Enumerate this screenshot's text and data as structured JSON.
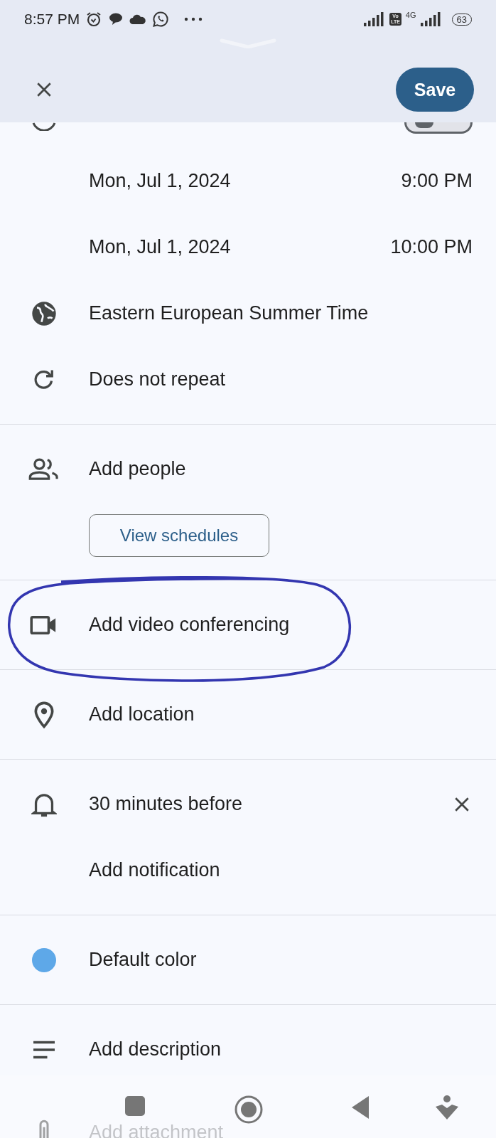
{
  "status_bar": {
    "time": "8:57 PM",
    "volte": [
      "Vo",
      "LTE"
    ],
    "network": "4G",
    "battery": "63"
  },
  "header": {
    "save_button": "Save"
  },
  "all_day_toggle": {
    "on": false
  },
  "sections": [
    {
      "rows": [
        {
          "kind": "datetime",
          "date": "Mon, Jul 1, 2024",
          "time": "9:00 PM"
        },
        {
          "kind": "datetime",
          "date": "Mon, Jul 1, 2024",
          "time": "10:00 PM"
        },
        {
          "kind": "timezone",
          "label": "Eastern European Summer Time"
        },
        {
          "kind": "repeat",
          "label": "Does not repeat"
        }
      ]
    },
    {
      "rows": [
        {
          "kind": "people",
          "label": "Add people",
          "button": "View schedules"
        }
      ]
    },
    {
      "rows": [
        {
          "kind": "video",
          "label": "Add video conferencing"
        }
      ]
    },
    {
      "rows": [
        {
          "kind": "location",
          "label": "Add location"
        }
      ]
    },
    {
      "rows": [
        {
          "kind": "notification",
          "label": "30 minutes before",
          "removable": true
        },
        {
          "kind": "plain",
          "label": "Add notification"
        }
      ]
    },
    {
      "rows": [
        {
          "kind": "color",
          "label": "Default color",
          "color": "#5ea8e8"
        }
      ]
    },
    {
      "rows": [
        {
          "kind": "description",
          "label": "Add description"
        },
        {
          "kind": "attachment",
          "label": "Add attachment"
        }
      ]
    }
  ]
}
